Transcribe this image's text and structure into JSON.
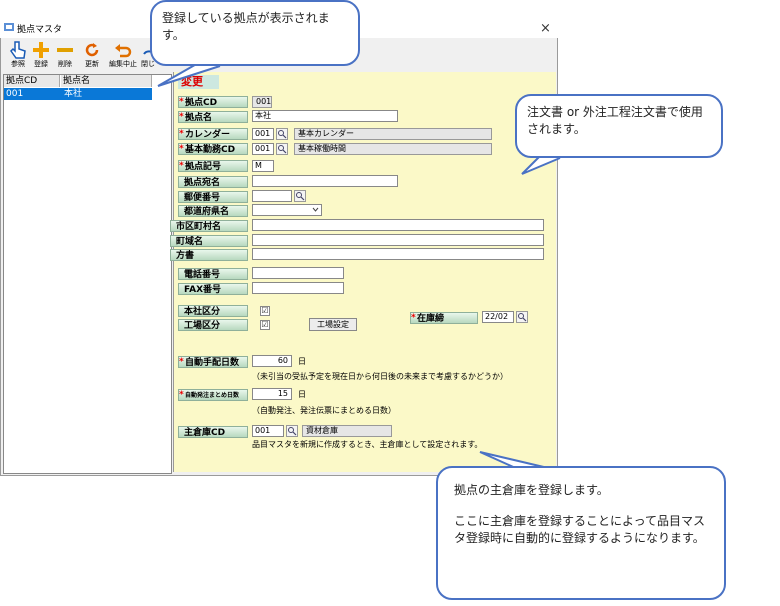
{
  "window": {
    "title": "拠点マスタ",
    "close": "×"
  },
  "toolbar": [
    {
      "label": "参照",
      "icon": "hand-pointer-icon"
    },
    {
      "label": "登録",
      "icon": "plus-icon"
    },
    {
      "label": "削除",
      "icon": "minus-icon"
    },
    {
      "label": "更新",
      "icon": "refresh-icon"
    },
    {
      "label": "編集中止",
      "icon": "undo-arrow-icon"
    },
    {
      "label": "閉じ",
      "icon": "close-door-icon"
    }
  ],
  "list": {
    "headers": [
      "拠点CD",
      "拠点名"
    ],
    "rows": [
      {
        "cd": "001",
        "name": "本社"
      }
    ]
  },
  "form": {
    "mode": "変更",
    "fields": {
      "code": {
        "label": "拠点CD",
        "value": "001"
      },
      "name": {
        "label": "拠点名",
        "value": "本社"
      },
      "calendar": {
        "label": "カレンダー",
        "value": "001",
        "desc": "基本カレンダー"
      },
      "workhours": {
        "label": "基本勤務CD",
        "value": "001",
        "desc": "基本稼働時間"
      },
      "symbol": {
        "label": "拠点記号",
        "value": "M"
      },
      "addressee": {
        "label": "拠点宛名",
        "value": ""
      },
      "postal": {
        "label": "郵便番号",
        "value": ""
      },
      "prefecture": {
        "label": "都道府県名",
        "value": ""
      },
      "city": {
        "label": "市区町村名",
        "value": ""
      },
      "town": {
        "label": "町域名",
        "value": ""
      },
      "street": {
        "label": "方書",
        "value": ""
      },
      "phone": {
        "label": "電話番号",
        "value": ""
      },
      "fax": {
        "label": "FAX番号",
        "value": ""
      },
      "head_office": {
        "label": "本社区分",
        "checked": "☑"
      },
      "factory": {
        "label": "工場区分",
        "checked": "☑"
      },
      "factory_btn": "工場設定",
      "stock_line": {
        "label": "在庫締",
        "value": "22/02"
      },
      "auto_days": {
        "label": "自動手配日数",
        "value": "60",
        "unit": "日",
        "note": "（未引当の受払予定を現在日から何日後の未来まで考慮するかどうか）"
      },
      "auto_bundle": {
        "label": "自動発注まとめ日数",
        "value": "15",
        "unit": "日",
        "note": "（自動発注、発注伝票にまとめる日数）"
      },
      "main_warehouse": {
        "label": "主倉庫CD",
        "value": "001",
        "desc": "資材倉庫",
        "note": "品目マスタを新規に作成するとき、主倉庫として設定されます。"
      }
    }
  },
  "callouts": {
    "top": "登録している拠点が表示されます。",
    "right": "注文書 or 外注工程注文書で使用されます。",
    "bottom_title": "拠点の主倉庫を登録します。",
    "bottom_body": "ここに主倉庫を登録することによって品目マスタ登録時に自動的に登録するようになります。"
  }
}
